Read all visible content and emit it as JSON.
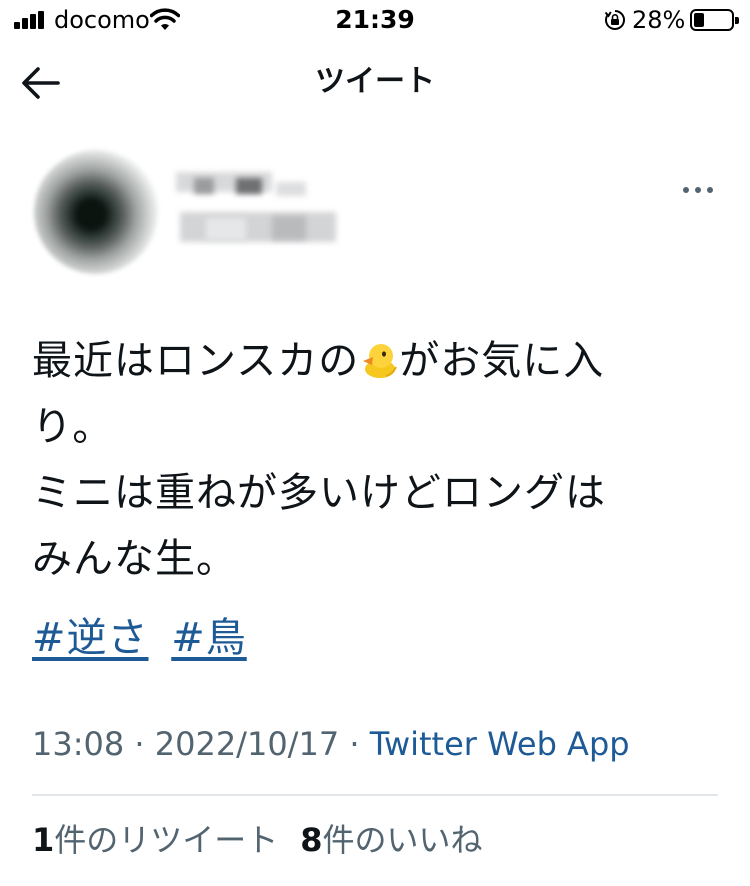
{
  "status_bar": {
    "carrier": "docomo",
    "time": "21:39",
    "battery_percent": "28%",
    "battery_level": 0.28,
    "icons": [
      "signal-icon",
      "wifi-icon",
      "rotation-lock-icon",
      "battery-icon"
    ]
  },
  "header": {
    "title": "ツイート",
    "back_icon": "back-arrow-icon",
    "more_icon": "more-icon"
  },
  "tweet": {
    "line1": "最近はロンスカの",
    "emoji": "baby-chick",
    "line1_rest": "がお気に入",
    "line2": "り。",
    "line3": "ミニは重ねが多いけどロングは",
    "line4": "みんな生。",
    "hashtags": [
      "#逆さ",
      "#鳥"
    ],
    "time": "13:08",
    "separator": "·",
    "date": "2022/10/17",
    "source": "Twitter Web App"
  },
  "stats": {
    "retweets_count": "1",
    "retweets_label": "件のリツイート",
    "likes_count": "8",
    "likes_label": "件のいいね"
  },
  "colors": {
    "link": "#1d5a96",
    "text": "#0f1419",
    "secondary": "#536471",
    "divider": "#e2e6e9"
  }
}
